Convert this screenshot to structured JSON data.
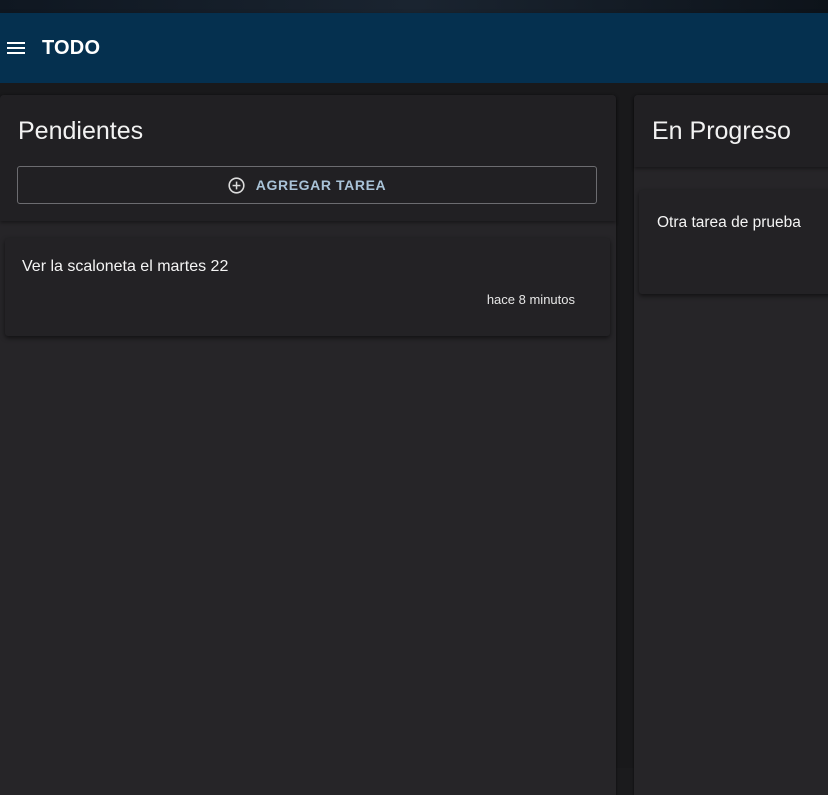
{
  "appbar": {
    "menu_icon": "hamburger-menu-icon",
    "title": "TODO",
    "background": "#05304f"
  },
  "columns": [
    {
      "title": "Pendientes",
      "add_button": {
        "icon": "add-circle-icon",
        "label": "AGREGAR TAREA",
        "label_color": "#a9c3d8"
      },
      "cards": [
        {
          "text": "Ver la scaloneta el martes 22",
          "time": "hace 8 minutos"
        }
      ]
    },
    {
      "title": "En Progreso",
      "cards": [
        {
          "text": "Otra tarea de prueba"
        }
      ]
    }
  ]
}
